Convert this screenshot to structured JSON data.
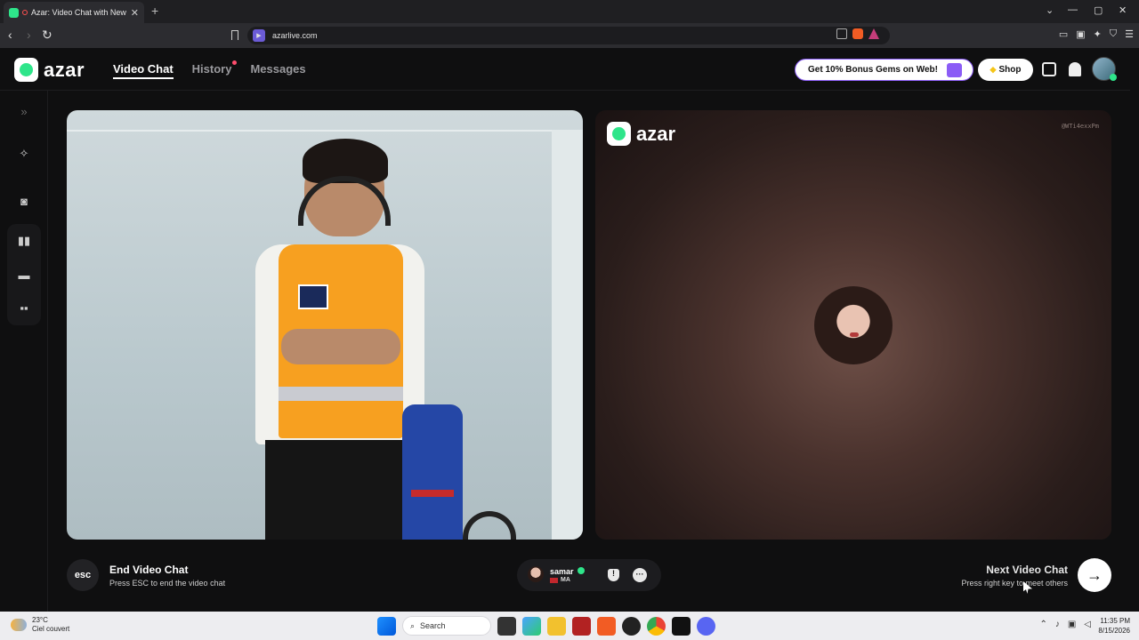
{
  "browser": {
    "tab_title": "Azar: Video Chat with New Pe",
    "url": "azarlive.com",
    "new_tab": "+"
  },
  "header": {
    "logo_text": "azar",
    "nav": {
      "video_chat": "Video Chat",
      "history": "History",
      "messages": "Messages"
    },
    "promo_text": "Get 10% Bonus Gems on Web!",
    "shop_label": "Shop"
  },
  "remote": {
    "logo_text": "azar",
    "watermark": "@WTi4exxPm"
  },
  "controls": {
    "esc_label": "esc",
    "end_title": "End Video Chat",
    "end_hint": "Press ESC to end the video chat",
    "peer_name": "samar",
    "peer_country": "MA",
    "next_title": "Next Video Chat",
    "next_hint": "Press right key to meet others",
    "next_arrow": "→"
  },
  "taskbar": {
    "temp": "23°C",
    "weather_desc": "Ciel couvert",
    "search_label": "Search",
    "time": "11:35 PM",
    "date": "8/15/2026"
  },
  "colors": {
    "brand_green": "#2ee58a",
    "accent_purple": "#8b5cf6",
    "background": "#0f0f10"
  }
}
